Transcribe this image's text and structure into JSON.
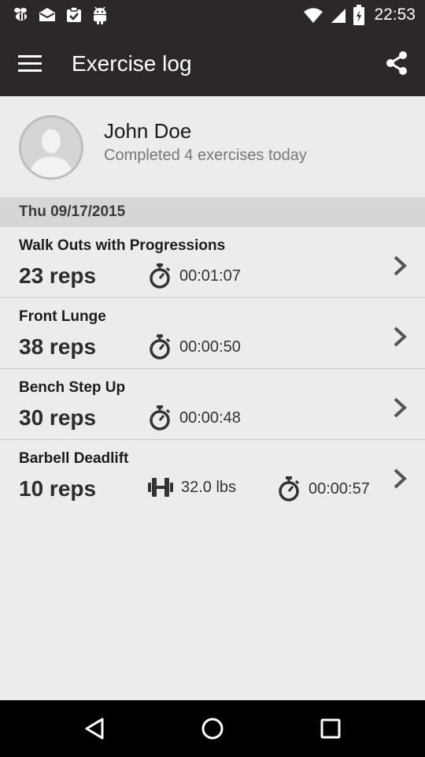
{
  "status_bar": {
    "time": "22:53",
    "icons": [
      "bee-icon",
      "mail-icon",
      "clipboard-check-icon",
      "android-icon",
      "wifi-icon",
      "signal-icon",
      "battery-charging-icon"
    ]
  },
  "app_bar": {
    "title": "Exercise log",
    "menu_icon": "hamburger-menu-icon",
    "share_icon": "share-icon"
  },
  "profile": {
    "name": "John Doe",
    "subtitle": "Completed 4 exercises today"
  },
  "log": {
    "date": "Thu 09/17/2015",
    "entries": [
      {
        "name": "Walk Outs with Progressions",
        "reps": "23 reps",
        "time": "00:01:07"
      },
      {
        "name": "Front Lunge",
        "reps": "38 reps",
        "time": "00:00:50"
      },
      {
        "name": "Bench Step Up",
        "reps": "30 reps",
        "time": "00:00:48"
      },
      {
        "name": "Barbell Deadlift",
        "reps": "10 reps",
        "weight": "32.0 lbs",
        "time": "00:00:57"
      }
    ]
  },
  "nav_bar": {
    "icons": [
      "back-icon",
      "home-icon",
      "recents-icon"
    ]
  }
}
